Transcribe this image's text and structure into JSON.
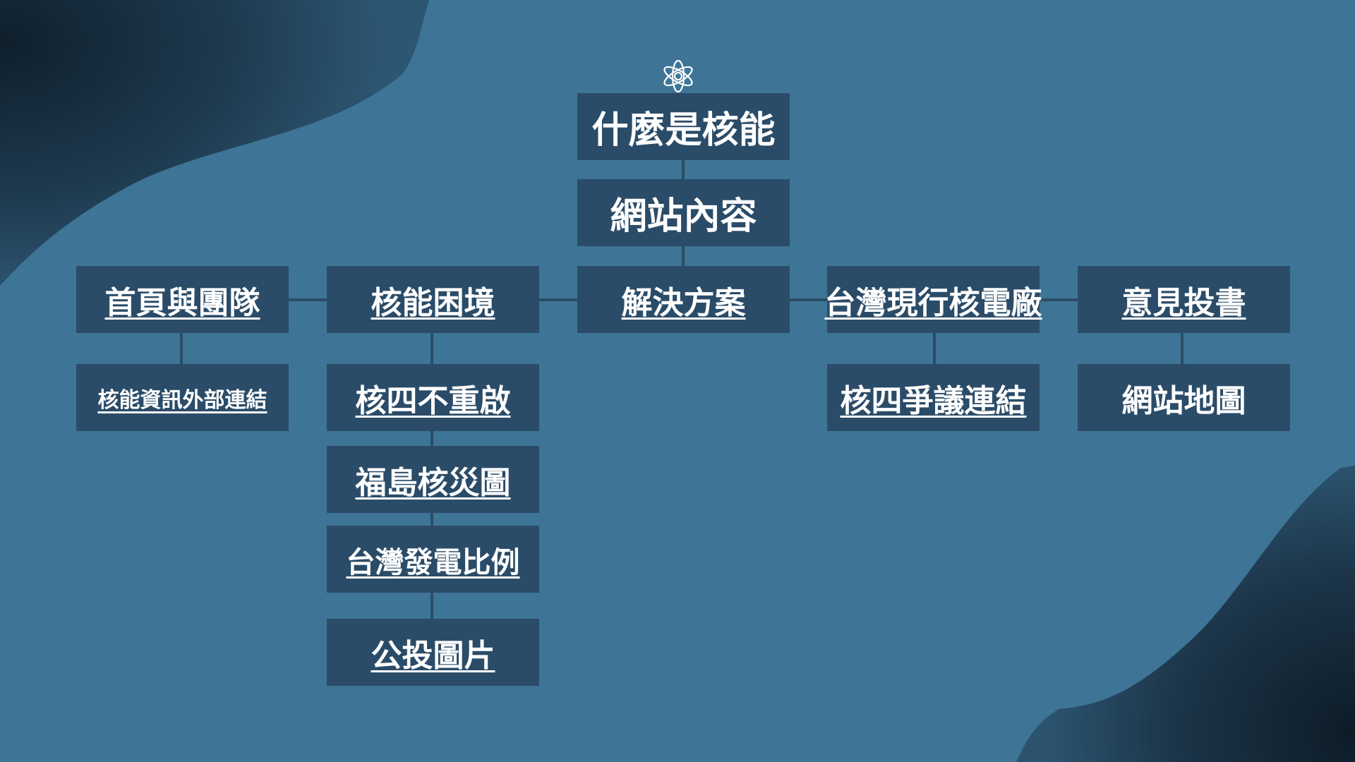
{
  "colors": {
    "background": "#3e7596",
    "box": "#2b4c68",
    "connector": "#2a4d66",
    "text": "#ffffff",
    "dark_shape": "#122536"
  },
  "header_icon": "atom-icon",
  "title": "什麼是核能",
  "site_content": "網站內容",
  "sections": {
    "home": "首頁與團隊",
    "dilemma": "核能困境",
    "solution": "解決方案",
    "plants": "台灣現行核電廠",
    "opinion": "意見投書"
  },
  "subpages": {
    "home_links": "核能資訊外部連結",
    "no_restart": "核四不重啟",
    "fukushima": "福島核災圖",
    "power_ratio": "台灣發電比例",
    "referendum": "公投圖片",
    "controversy": "核四爭議連結",
    "sitemap": "網站地圖"
  }
}
